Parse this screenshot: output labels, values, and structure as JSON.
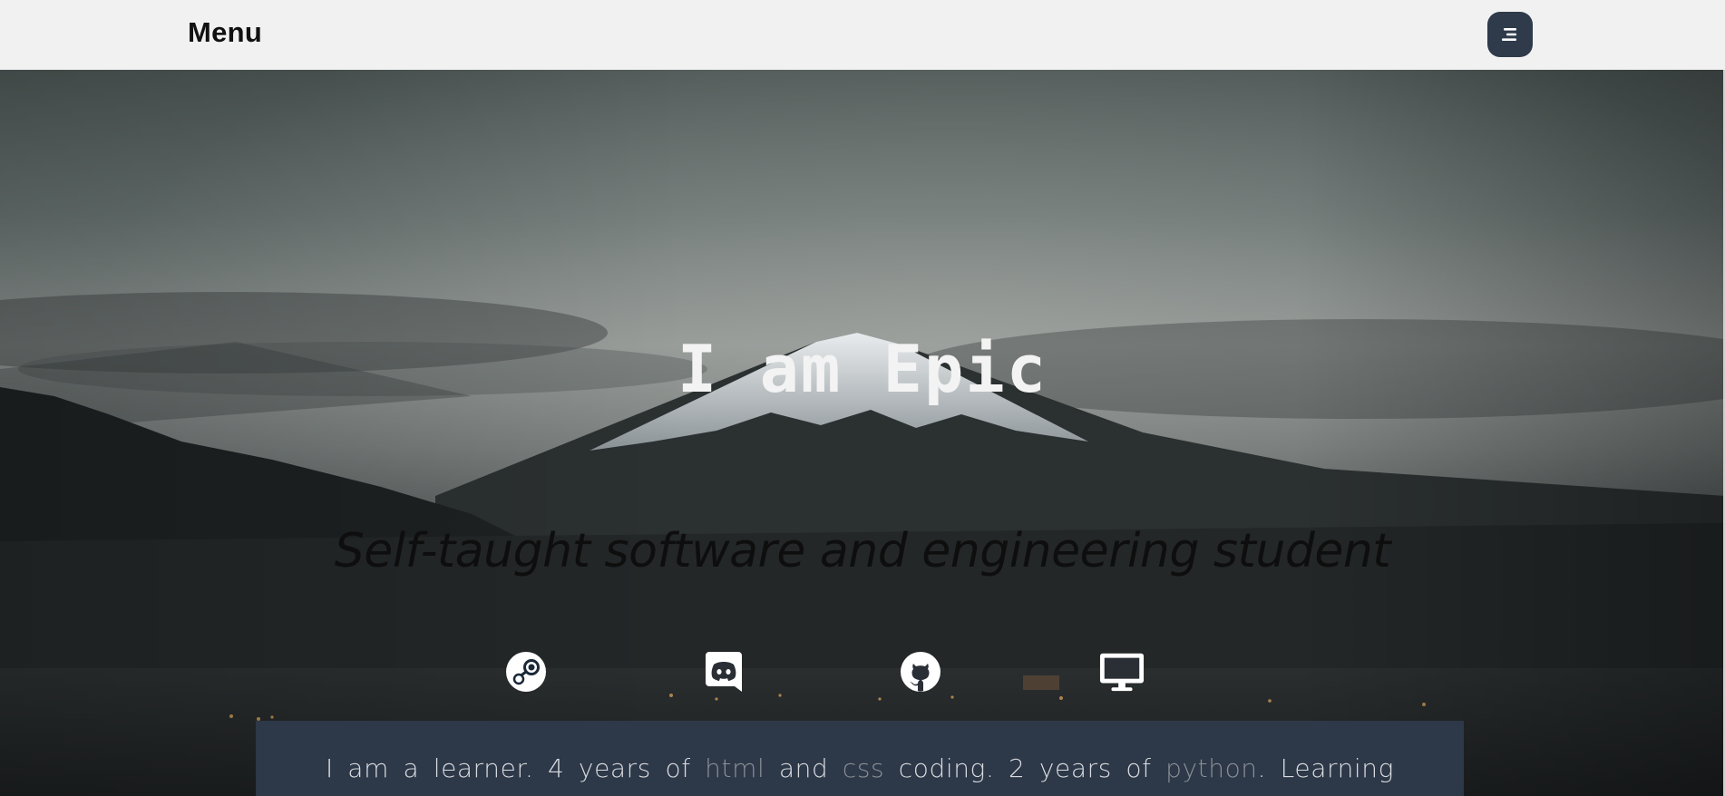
{
  "navbar": {
    "brand": "Menu",
    "menu_icon": "hamburger-menu-icon"
  },
  "hero": {
    "title": "I am Epic",
    "subtitle": "Self-taught software and engineering student"
  },
  "social_links": [
    {
      "icon": "steam-icon"
    },
    {
      "icon": "discord-icon"
    },
    {
      "icon": "github-icon"
    },
    {
      "icon": "monitor-icon"
    }
  ],
  "about": {
    "p1": "I am a learner. 4 years of ",
    "k1": "html",
    "p2": " and ",
    "k2": "css",
    "p3": " coding. 2 years of ",
    "k3": "python",
    "p4": ". Learning"
  },
  "colors": {
    "navbar_bg": "#f1f1f1",
    "menu_button_bg": "#2f3a4b",
    "about_panel_bg": "#2d3848",
    "highlight_text": "#8a8f97"
  }
}
